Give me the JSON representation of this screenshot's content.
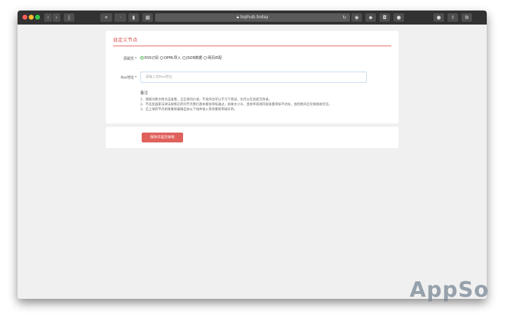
{
  "browser": {
    "url": "tophub.today",
    "lock_icon": "lock-icon",
    "lights": [
      "#fc5f57",
      "#fdbc2e",
      "#33c748"
    ]
  },
  "form": {
    "title": "自定义节点",
    "source_label": "源属性 *",
    "options": [
      {
        "label": "RSS订阅",
        "checked": true
      },
      {
        "label": "OPML导入",
        "checked": false
      },
      {
        "label": "JSON数据",
        "checked": false
      },
      {
        "label": "网页匹配",
        "checked": false
      }
    ],
    "rss_label": "Rss地址 *",
    "rss_placeholder": "请输入您Rss地址",
    "notes_title": "备注",
    "notes": [
      "1、搜取间距文档点击查看，全正则的价值，不会的也可以学习下或试，也可以在此提交改录。",
      "2、不违反国家法律法规和已存的节点我们基本都会审核通过，如果太小众，且榜单或请内容质量审核不达标，会酌情开启仅限接收可见。",
      "3、已上线的节点如果重新编辑自会以下线并进入等待重新审核队列。"
    ],
    "submit_label": "保存并提交审核"
  },
  "watermark": "AppSo"
}
